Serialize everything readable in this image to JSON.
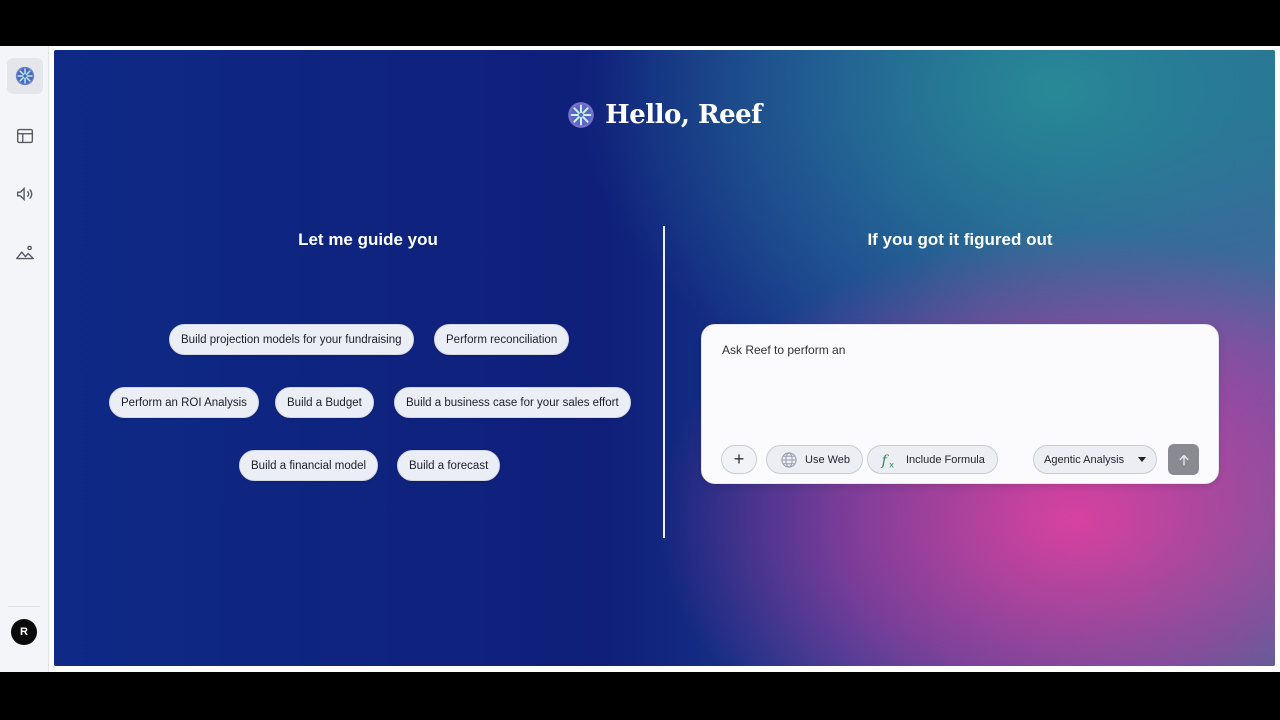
{
  "app": {
    "greeting": "Hello, Reef",
    "brand_color": "#0f1f7a",
    "accent_color": "#e240a0"
  },
  "sidebar": {
    "items": [
      {
        "icon": "reef-logo-icon",
        "active": true
      },
      {
        "icon": "table-icon",
        "active": false
      },
      {
        "icon": "speaker-icon",
        "active": false
      },
      {
        "icon": "image-icon",
        "active": false
      }
    ],
    "avatar_initial": "R"
  },
  "guide": {
    "title": "Let me guide you",
    "suggestions": [
      "Build projection models for your fundraising",
      "Perform reconciliation",
      "Perform an ROI Analysis",
      "Build a Budget",
      "Build a business case for your sales effort",
      "Build a financial model",
      "Build a forecast"
    ]
  },
  "prompt": {
    "title": "If you got it figured out",
    "text": "Ask Reef to perform an",
    "add_label": "+",
    "use_web_label": "Use Web",
    "include_formula_label": "Include Formula",
    "mode_selected": "Agentic Analysis",
    "send_icon": "arrow-up-icon"
  }
}
